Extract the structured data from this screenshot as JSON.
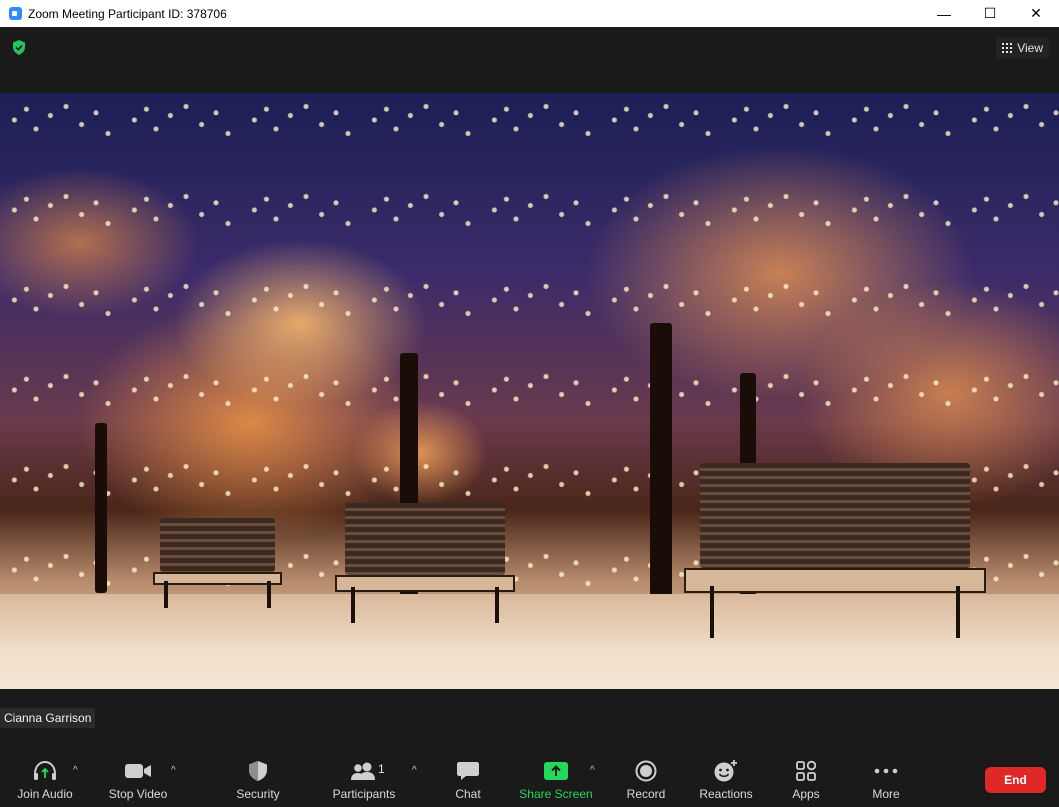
{
  "window": {
    "title": "Zoom Meeting Participant ID: 378706",
    "minimize_glyph": "—",
    "maximize_glyph": "☐",
    "close_glyph": "✕"
  },
  "header": {
    "security_status_icon": "shield-check-icon",
    "view_label": "View"
  },
  "video": {
    "participant_name": "Cianna Garrison",
    "scene": "snowy-park-night-lights"
  },
  "toolbar": {
    "join_audio": "Join Audio",
    "stop_video": "Stop Video",
    "security": "Security",
    "participants": "Participants",
    "participant_count": "1",
    "chat": "Chat",
    "share_screen": "Share Screen",
    "record": "Record",
    "reactions": "Reactions",
    "apps": "Apps",
    "more": "More",
    "end": "End",
    "caret": "^"
  },
  "colors": {
    "background": "#1a1a1a",
    "share_green": "#23d959",
    "end_red": "#e02828",
    "shield_green": "#23c55e"
  }
}
